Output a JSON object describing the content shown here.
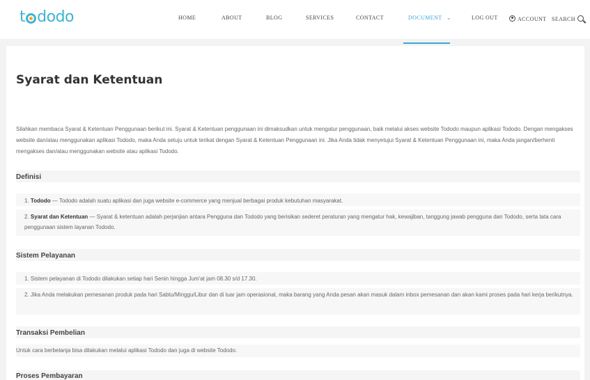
{
  "brand": {
    "logo_prefix": "t",
    "logo_suffix": "dodo"
  },
  "nav": {
    "home": "HOME",
    "about": "ABOUT",
    "blog": "BLOG",
    "services": "SERVICES",
    "contact": "CONTACT",
    "document": "DOCUMENT",
    "document_arrow": "⌄",
    "logout": "LOG OUT",
    "account": "ACCOUNT",
    "search": "SEARCH",
    "active_color": "#3aa6d8"
  },
  "page": {
    "title": "Syarat dan Ketentuan",
    "intro": "Silahkan membaca Syarat & Ketentuan Penggunaan berikut ini. Syarat & Ketentuan penggunaan ini dimaksudkan untuk mengatur penggunaan, baik melalui akses website Tododo maupun aplikasi Tododo. Dengan mengakses website dan/atau menggunakan aplikasi Tododo, maka Anda setuju untuk terikat dengan Syarat & Ketentuan Penggunaan ini. Jika Anda tidak menyetujui Syarat & Ketentuan Penggunaan ini, maka Anda jangan/berhenti mengakses dan/atau menggunakan website atau aplikasi Tododo."
  },
  "sections": {
    "definisi": {
      "title": "Definisi",
      "items": [
        {
          "num": "1.",
          "term": "Tododo",
          "text": " — Tododo adalah suatu aplikasi dan juga website e-commerce yang menjual berbagai produk kebutuhan masyarakat."
        },
        {
          "num": "2.",
          "term": "Syarat dan Ketentuan",
          "text": " — Syarat & ketentuan adalah perjanjian antara Pengguna dan Tododo yang berisikan sederet peraturan yang mengatur hak, kewajiban, tanggung jawab pengguna dan Tododo, serta tata cara penggunaan sistem layanan Tododo."
        }
      ]
    },
    "sistem": {
      "title": "Sistem Pelayanan",
      "items": [
        {
          "num": "1.",
          "text": "Sistem pelayanan di Tododo dilakukan setiap hari Senin hingga Jum'at jam 08.30 s/d 17.30."
        },
        {
          "num": "2.",
          "text": "Jika Anda melakukan pemesanan produk pada hari Sabtu/Minggu/Libur dan di luar jam operasional, maka barang yang Anda pesan akan masuk dalam inbox pemesanan dan akan kami proses pada hari kerja berikutnya."
        }
      ]
    },
    "transaksi": {
      "title": "Transaksi Pembelian",
      "text": "Untuk cara berbelanja bisa dilakukan melalui aplikasi Tododo dan juga di website Tododo."
    },
    "proses": {
      "title": "Proses Pembayaran"
    }
  }
}
